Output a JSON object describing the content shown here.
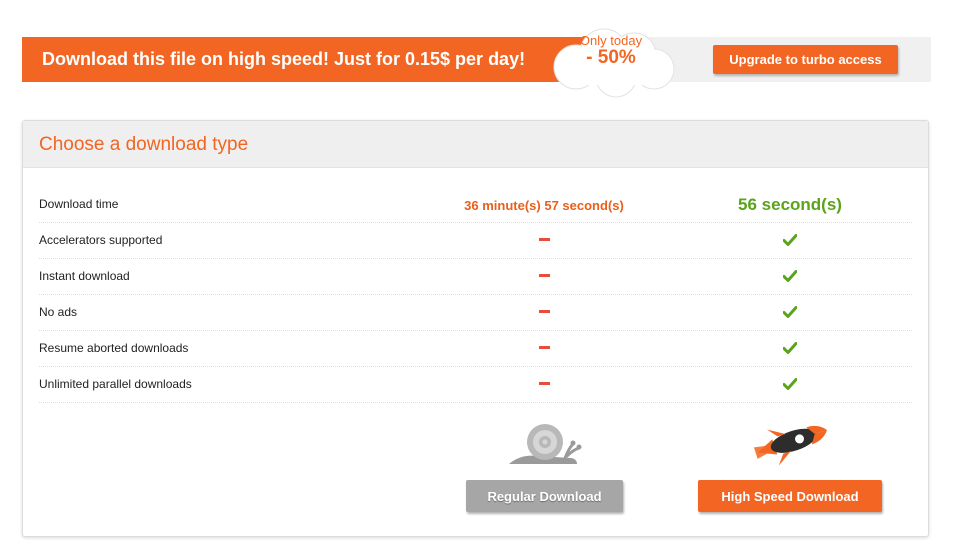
{
  "banner": {
    "text": "Download this file on high speed! Just for 0.15$ per day!",
    "promo_line1": "Only today",
    "promo_line2": "- 50%",
    "upgrade_label": "Upgrade to turbo access"
  },
  "panel": {
    "title": "Choose a download type",
    "features": [
      {
        "label": "Download time",
        "regular": "36 minute(s) 57 second(s)",
        "turbo": "56 second(s)"
      },
      {
        "label": "Accelerators supported",
        "regular_icon": "dash-icon",
        "turbo_icon": "check-icon"
      },
      {
        "label": "Instant download",
        "regular_icon": "dash-icon",
        "turbo_icon": "check-icon"
      },
      {
        "label": "No ads",
        "regular_icon": "dash-icon",
        "turbo_icon": "check-icon"
      },
      {
        "label": "Resume aborted downloads",
        "regular_icon": "dash-icon",
        "turbo_icon": "check-icon"
      },
      {
        "label": "Unlimited parallel downloads",
        "regular_icon": "dash-icon",
        "turbo_icon": "check-icon"
      }
    ],
    "regular_icon": "snail-icon",
    "turbo_icon": "rocket-icon",
    "regular_button": "Regular Download",
    "highspeed_button": "High Speed Download"
  },
  "colors": {
    "accent": "#f26522",
    "turbo_green": "#5aa31b",
    "dash_red": "#e84c3d",
    "regular_gray": "#a6a6a6"
  }
}
